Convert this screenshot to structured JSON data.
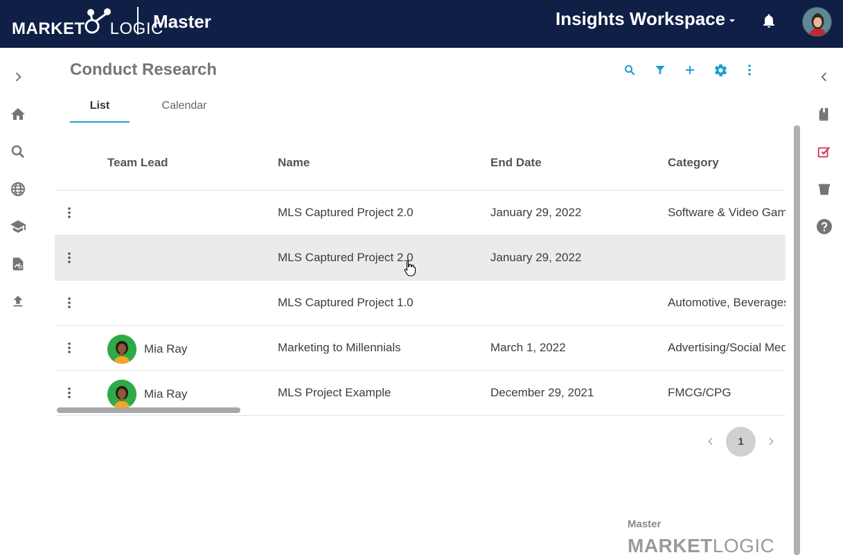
{
  "header": {
    "brand_left": "MARKET",
    "brand_right": "LOGIC",
    "product": "Master",
    "workspace": "Insights Workspace"
  },
  "page": {
    "title": "Conduct Research",
    "tabs": [
      {
        "label": "List",
        "active": true
      },
      {
        "label": "Calendar",
        "active": false
      }
    ]
  },
  "toolbar": {
    "icons": [
      "search-icon",
      "filter-icon",
      "add-icon",
      "settings-icon",
      "more-vertical-icon"
    ]
  },
  "left_nav": {
    "icons": [
      "chevron-right-icon",
      "home-icon",
      "search-icon",
      "globe-icon",
      "graduation-cap-icon",
      "report-icon",
      "upload-icon"
    ]
  },
  "right_nav": {
    "icons": [
      "chevron-left-icon",
      "book-icon",
      "checklist-icon",
      "bucket-icon",
      "help-icon"
    ]
  },
  "table": {
    "columns": [
      "Team Lead",
      "Name",
      "End Date",
      "Category"
    ],
    "rows": [
      {
        "lead": "",
        "name": "MLS Captured Project 2.0",
        "end_date": "January 29, 2022",
        "category": "Software & Video Games"
      },
      {
        "lead": "",
        "name": "MLS Captured Project 2.0",
        "end_date": "January 29, 2022",
        "category": ""
      },
      {
        "lead": "",
        "name": "MLS Captured Project 1.0",
        "end_date": "",
        "category": "Automotive, Beverages"
      },
      {
        "lead": "Mia Ray",
        "name": "Marketing to Millennials",
        "end_date": "March 1, 2022",
        "category": "Advertising/Social Media"
      },
      {
        "lead": "Mia Ray",
        "name": "MLS Project Example",
        "end_date": "December 29, 2021",
        "category": "FMCG/CPG"
      }
    ]
  },
  "pagination": {
    "current": "1"
  },
  "footer": {
    "label": "Master",
    "brand_left": "MARKET",
    "brand_right": "LOGIC"
  },
  "colors": {
    "header_bg": "#0f1f45",
    "accent": "#1a9fd0",
    "alert": "#d2325a"
  }
}
